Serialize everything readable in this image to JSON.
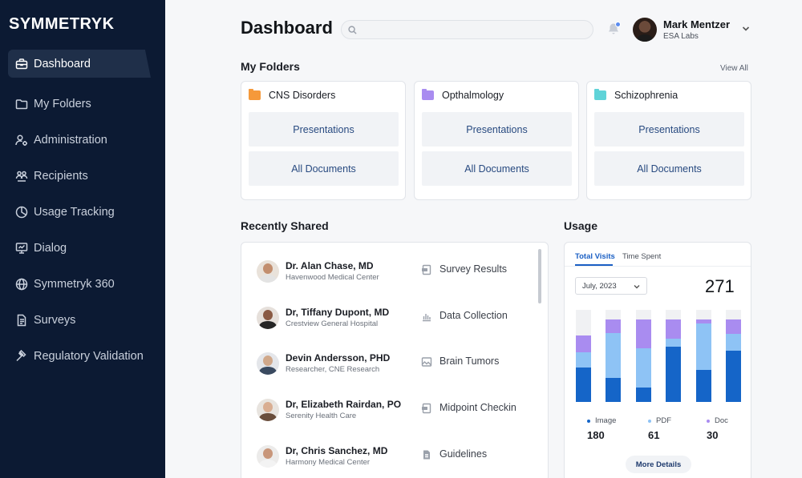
{
  "brand": "SYMMETRYK",
  "sidebar": {
    "items": [
      {
        "label": "Dashboard",
        "icon": "briefcase-icon",
        "active": true
      },
      {
        "label": "My Folders",
        "icon": "folder-icon"
      },
      {
        "label": "Administration",
        "icon": "user-gear-icon"
      },
      {
        "label": "Recipients",
        "icon": "users-icon"
      },
      {
        "label": "Usage Tracking",
        "icon": "pie-chart-icon"
      },
      {
        "label": "Dialog",
        "icon": "presentation-icon"
      },
      {
        "label": "Symmetryk 360",
        "icon": "globe-icon"
      },
      {
        "label": "Surveys",
        "icon": "document-icon"
      },
      {
        "label": "Regulatory Validation",
        "icon": "gavel-icon"
      }
    ]
  },
  "header": {
    "title": "Dashboard",
    "search": {
      "value": "",
      "placeholder": ""
    },
    "user": {
      "name": "Mark Mentzer",
      "org": "ESA Labs"
    }
  },
  "folders": {
    "title": "My Folders",
    "view_all": "View All",
    "items": [
      {
        "name": "CNS Disorders",
        "color": "#f5993a",
        "btn1": "Presentations",
        "btn2": "All Documents"
      },
      {
        "name": "Opthalmology",
        "color": "#a98cf0",
        "btn1": "Presentations",
        "btn2": "All Documents"
      },
      {
        "name": "Schizophrenia",
        "color": "#5fd3d8",
        "btn1": "Presentations",
        "btn2": "All Documents"
      }
    ]
  },
  "shared": {
    "title": "Recently Shared",
    "rows": [
      {
        "name": "Dr. Alan Chase, MD",
        "org": "Havenwood Medical Center",
        "doc": "Survey Results",
        "doc_icon": "pdf-icon"
      },
      {
        "name": "Dr, Tiffany Dupont, MD",
        "org": "Crestview General Hospital",
        "doc": "Data Collection",
        "doc_icon": "bar-chart-icon"
      },
      {
        "name": "Devin Andersson, PHD",
        "org": "Researcher, CNE Research",
        "doc": "Brain Tumors",
        "doc_icon": "image-icon"
      },
      {
        "name": "Dr, Elizabeth Rairdan, PO",
        "org": "Serenity Health Care",
        "doc": "Midpoint Checkin",
        "doc_icon": "pdf-icon"
      },
      {
        "name": "Dr, Chris Sanchez, MD",
        "org": "Harmony Medical Center",
        "doc": "Guidelines",
        "doc_icon": "file-icon"
      }
    ]
  },
  "usage": {
    "title": "Usage",
    "tabs": [
      "Total Visits",
      "Time Spent"
    ],
    "month": "July, 2023",
    "total": "271",
    "legend": [
      {
        "label": "Image",
        "value": "180",
        "color": "#1565c8"
      },
      {
        "label": "PDF",
        "value": "61",
        "color": "#8ec3f5"
      },
      {
        "label": "Doc",
        "value": "30",
        "color": "#a98cf0"
      }
    ],
    "more": "More Details",
    "colors": {
      "image": "#1565c8",
      "pdf": "#8ec3f5",
      "doc": "#a98cf0",
      "empty": "#f0f1f3"
    },
    "bars": [
      {
        "image": 0.37,
        "pdf": 0.17,
        "doc": 0.18,
        "empty": 0.28
      },
      {
        "image": 0.26,
        "pdf": 0.49,
        "doc": 0.15,
        "empty": 0.1
      },
      {
        "image": 0.16,
        "pdf": 0.42,
        "doc": 0.32,
        "empty": 0.1
      },
      {
        "image": 0.6,
        "pdf": 0.09,
        "doc": 0.21,
        "empty": 0.1
      },
      {
        "image": 0.35,
        "pdf": 0.5,
        "doc": 0.05,
        "empty": 0.1
      },
      {
        "image": 0.56,
        "pdf": 0.18,
        "doc": 0.16,
        "empty": 0.1
      }
    ]
  }
}
